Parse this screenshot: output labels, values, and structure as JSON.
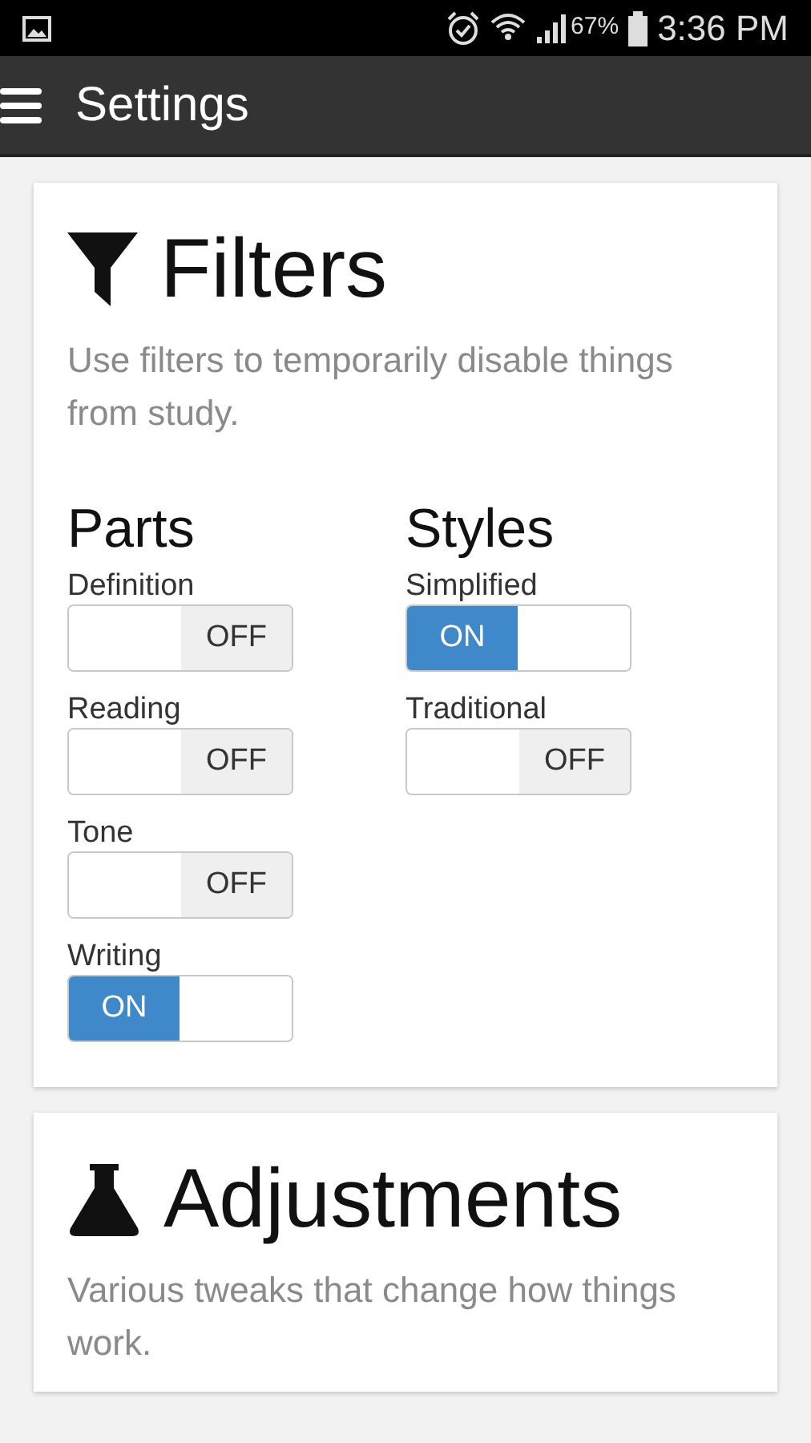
{
  "status_bar": {
    "battery": "67%",
    "time": "3:36 PM"
  },
  "app_bar": {
    "title": "Settings"
  },
  "cards": [
    {
      "kind": "filters",
      "title": "Filters",
      "description": "Use filters to temporarily disable things from study.",
      "groups": [
        {
          "title": "Parts",
          "switches": [
            {
              "label": "Definition",
              "on": false,
              "state_text": "OFF"
            },
            {
              "label": "Reading",
              "on": false,
              "state_text": "OFF"
            },
            {
              "label": "Tone",
              "on": false,
              "state_text": "OFF"
            },
            {
              "label": "Writing",
              "on": true,
              "state_text": "ON"
            }
          ]
        },
        {
          "title": "Styles",
          "switches": [
            {
              "label": "Simplified",
              "on": true,
              "state_text": "ON"
            },
            {
              "label": "Traditional",
              "on": false,
              "state_text": "OFF"
            }
          ]
        }
      ]
    },
    {
      "kind": "adjustments",
      "title": "Adjustments",
      "description": "Various tweaks that change how things work."
    }
  ]
}
